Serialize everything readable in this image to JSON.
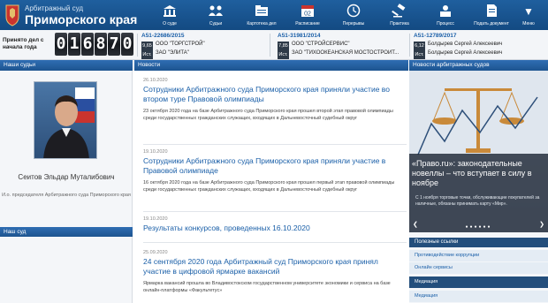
{
  "header": {
    "court_subtitle": "Арбитражный суд",
    "court_title": "Приморского края",
    "nav": [
      {
        "label": "О суде",
        "icon": "building-icon"
      },
      {
        "label": "Судьи",
        "icon": "judges-icon"
      },
      {
        "label": "Картотека дел",
        "icon": "folders-icon"
      },
      {
        "label": "Расписание",
        "icon": "calendar-icon"
      },
      {
        "label": "Перерывы",
        "icon": "clock-icon"
      },
      {
        "label": "Практика",
        "icon": "gavel-icon"
      },
      {
        "label": "Процесс",
        "icon": "process-icon"
      },
      {
        "label": "Подать документ",
        "icon": "document-icon"
      }
    ],
    "calendar_day": "02",
    "menu_label": "Меню"
  },
  "counter": {
    "label": "Принято дел с начала года",
    "digits": [
      "0",
      "1",
      "6",
      "8",
      "7",
      "0"
    ]
  },
  "cases": [
    {
      "number": "А51-22686/2015",
      "score": "9,65",
      "status": "Ист.",
      "party1": "ООО \"ТОРГСТРОЙ\"",
      "party2": "ЗАО \"ЭЛИТА\""
    },
    {
      "number": "А51-31981/2014",
      "score": "7,85",
      "status": "Ист.",
      "party1": "ООО \"СТРОЙСЕРВИС\"",
      "party2": "ЗАО \"ТИХООКЕАНСКАЯ МОСТОСТРОИТ..."
    },
    {
      "number": "А51-12789/2017",
      "score": "6,12",
      "status": "Ист.",
      "party1": "Болдырев Сергей Алексеевич",
      "party2": "Болдырев Сергей Алексеевич"
    }
  ],
  "left": {
    "header": "Наши судьи",
    "judge_name": "Сеитов Эльдар Муталибович",
    "judge_role": "И.о. председателя Арбитражного суда Приморского края",
    "section2": "Наш суд"
  },
  "news": {
    "header": "Новости",
    "items": [
      {
        "date": "26.10.2020",
        "title": "Сотрудники Арбитражного суда Приморского края приняли участие во втором туре Правовой олимпиады",
        "text": "23 октября 2020 года на базе Арбитражного суда Приморского края прошел второй этап правовой олимпиады среди государственных гражданских служащих, входящих в Дальневосточный судебный округ"
      },
      {
        "date": "19.10.2020",
        "title": "Сотрудники Арбитражного суда Приморского края приняли участие в Правовой олимпиаде",
        "text": "16 октября 2020 года на базе Арбитражного суда Приморского края прошел первый этап правовой олимпиады среди государственных гражданских служащих, входящих в Дальневосточный судебный округ"
      },
      {
        "date": "19.10.2020",
        "title": "Результаты конкурсов, проведенных 16.10.2020",
        "text": ""
      },
      {
        "date": "25.09.2020",
        "title": "24 сентября 2020 года Арбитражный суд Приморского края принял участие в цифровой ярмарке вакансий",
        "text": "Ярмарка вакансий прошла во Владивостокском государственном университете экономики и сервиса на базе онлайн-платформы «Факультетус»"
      }
    ]
  },
  "right": {
    "header": "Новости арбитражных судов",
    "featured_title": "«Право.ru»: законодательные новеллы – что вступает в силу в ноябре",
    "featured_text": "С 1 ноября торговые точки, обслуживающие покупателей за наличные, обязаны принимать карту «Мир».",
    "links_header": "Полезные ссылки",
    "links": [
      "Противодействие коррупции",
      "Онлайн сервисы",
      "Медиация",
      "Медиация"
    ]
  },
  "colors": {
    "brand": "#1c5592",
    "link": "#1a5fa8",
    "header_bg": "#1f5f9e"
  }
}
